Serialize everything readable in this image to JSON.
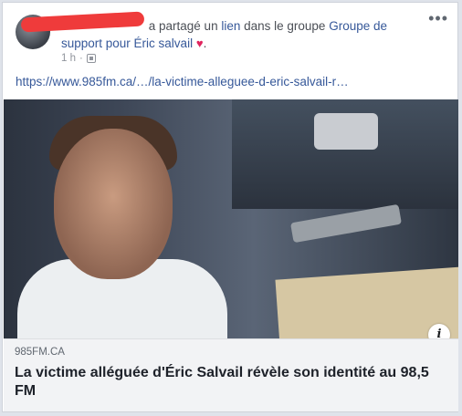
{
  "header": {
    "action_text": "a partagé un",
    "link_word": "lien",
    "group_prefix": "dans le groupe",
    "group_name": "Groupe de support pour Éric salvail",
    "heart": "♥",
    "period": ".",
    "time": "1 h",
    "privacy_icon": "group-privacy-icon",
    "more_icon": "more-options-icon",
    "more_glyph": "•••"
  },
  "post": {
    "url_text": "https://www.985fm.ca/…/la-victime-alleguee-d-eric-salvail-r…"
  },
  "link_card": {
    "domain": "985FM.CA",
    "title": "La victime alléguée d'Éric Salvail révèle son identité au 98,5 FM",
    "info_glyph": "i"
  }
}
